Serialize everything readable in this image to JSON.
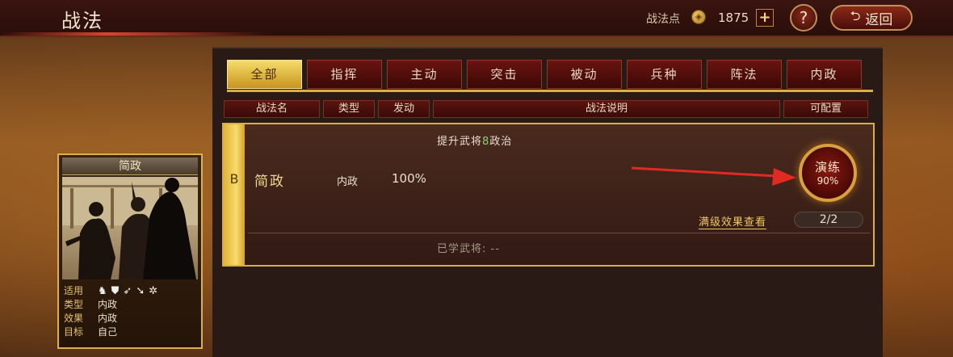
{
  "header": {
    "title": "战法",
    "points_label": "战法点",
    "points_icon": "coin-icon",
    "points_value": "1875",
    "plus_label": "+",
    "help_label": "?",
    "back_label": "返回"
  },
  "tabs": [
    {
      "label": "全部",
      "active": true
    },
    {
      "label": "指挥",
      "active": false
    },
    {
      "label": "主动",
      "active": false
    },
    {
      "label": "突击",
      "active": false
    },
    {
      "label": "被动",
      "active": false
    },
    {
      "label": "兵种",
      "active": false
    },
    {
      "label": "阵法",
      "active": false
    },
    {
      "label": "内政",
      "active": false
    }
  ],
  "columns": [
    "战法名",
    "类型",
    "发动",
    "战法说明",
    "可配置"
  ],
  "skill": {
    "grade": "B",
    "name": "简政",
    "type": "内政",
    "rate": "100%",
    "desc_prefix": "提升武将",
    "desc_num": "8",
    "desc_suffix": "政治",
    "train_label": "演练",
    "train_pct": "90%",
    "max_effect_link": "满级效果查看",
    "level": "2/2",
    "learned": "已学武将: --"
  },
  "card": {
    "name": "简政",
    "rows": [
      {
        "key": "适用",
        "value": ""
      },
      {
        "key": "类型",
        "value": "内政"
      },
      {
        "key": "效果",
        "value": "内政"
      },
      {
        "key": "目标",
        "value": "自己"
      }
    ],
    "unit_icons": [
      "cavalry-icon",
      "shield-icon",
      "bow-icon",
      "spear-icon",
      "wheel-icon"
    ]
  },
  "colors": {
    "accent_gold": "#d8b040",
    "tab_red": "#6a1410",
    "arrow_red": "#e02a22"
  }
}
